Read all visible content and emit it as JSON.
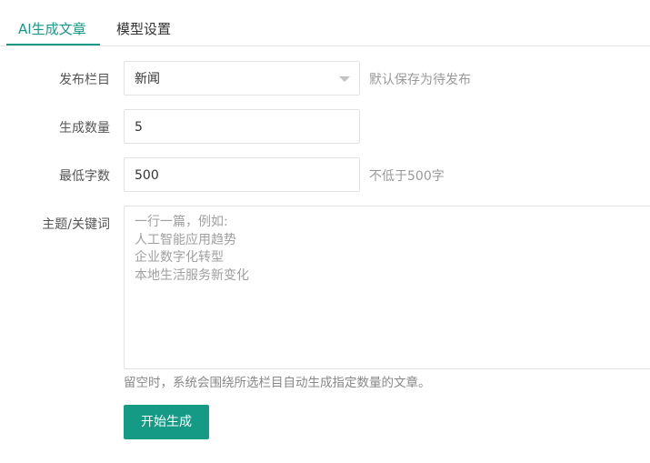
{
  "tabs": [
    {
      "label": "AI生成文章",
      "active": true
    },
    {
      "label": "模型设置",
      "active": false
    }
  ],
  "form": {
    "column": {
      "label": "发布栏目",
      "value": "新闻",
      "hint": "默认保存为待发布"
    },
    "count": {
      "label": "生成数量",
      "value": "5"
    },
    "min_words": {
      "label": "最低字数",
      "value": "500",
      "hint": "不低于500字"
    },
    "topics": {
      "label": "主题/关键词",
      "placeholder_lines": [
        "一行一篇，例如:",
        "人工智能应用趋势",
        "企业数字化转型",
        "本地生活服务新变化"
      ],
      "note": "留空时，系统会围绕所选栏目自动生成指定数量的文章。"
    },
    "submit_label": "开始生成"
  },
  "colors": {
    "accent": "#159a86",
    "border": "#e3e3e3",
    "hint": "#999999"
  }
}
